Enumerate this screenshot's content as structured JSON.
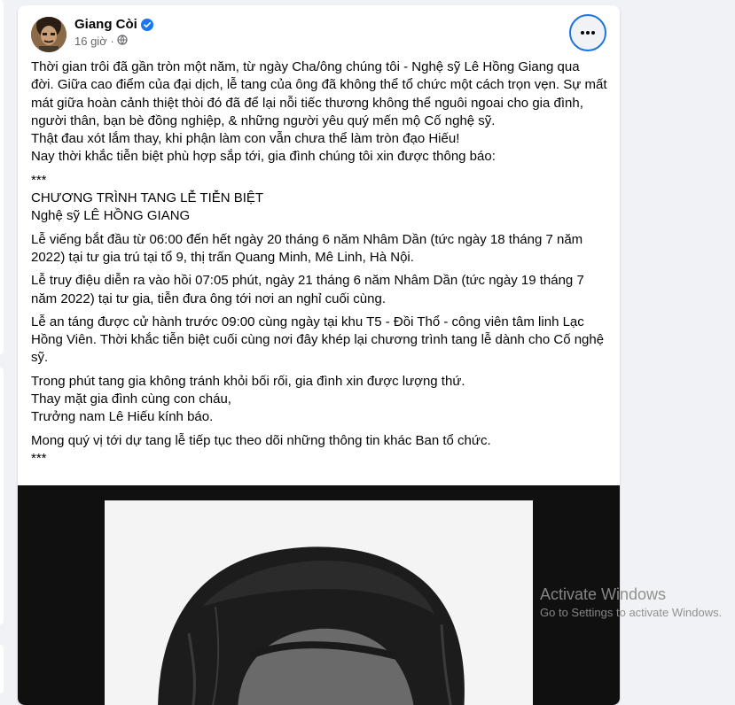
{
  "post": {
    "author": "Giang Còi",
    "time": "16 giờ ·",
    "icons": {
      "verified": "verified-badge-icon",
      "privacy": "globe-icon",
      "more": "more-options-icon"
    },
    "paragraphs": [
      {
        "lines": [
          "Thời gian trôi đã gần tròn một năm, từ ngày Cha/ông chúng tôi - Nghệ sỹ Lê Hồng Giang qua",
          "đời. Giữa cao điểm của đại dịch, lễ tang của ông đã không thể tổ chức một cách trọn vẹn. Sự mất",
          "mát giữa hoàn cảnh thiệt thòi đó đã để lại nỗi tiếc thương không thể nguôi ngoai cho gia đình,",
          "người thân, bạn bè đồng nghiệp, & những người yêu quý mến mộ Cố nghệ sỹ.",
          "Thật đau xót lắm thay, khi phận làm con vẫn chưa thể làm tròn đạo Hiếu!",
          "Nay thời khắc tiễn biệt phù hợp sắp tới, gia đình chúng tôi xin được thông báo:"
        ]
      },
      {
        "lines": [
          "***",
          "CHƯƠNG TRÌNH TANG LỄ TIỄN BIỆT",
          "Nghệ sỹ LÊ HỒNG GIANG"
        ]
      },
      {
        "lines": [
          "Lễ viếng bắt đầu từ 06:00 đến hết ngày 20 tháng 6 năm Nhâm Dần (tức ngày 18 tháng 7 năm",
          "2022) tại tư gia trú tại tổ 9, thị trấn Quang Minh, Mê Linh, Hà Nội."
        ]
      },
      {
        "lines": [
          "Lễ truy điệu diễn ra vào hồi 07:05 phút, ngày 21 tháng 6 năm Nhâm Dần (tức ngày 19 tháng 7",
          "năm 2022) tại tư gia, tiễn đưa ông tới nơi an nghỉ cuối cùng."
        ]
      },
      {
        "lines": [
          "Lễ an táng được cử hành trước 09:00 cùng ngày tại khu T5 - Đồi Thổ - công viên tâm linh Lạc",
          "Hồng Viên. Thời khắc tiễn biệt cuối cùng nơi đây khép lại chương trình tang lễ dành cho Cố nghệ",
          "sỹ."
        ]
      },
      {
        "lines": [
          "Trong phút tang gia không tránh khỏi bối rối, gia đình xin được lượng thứ.",
          "Thay mặt gia đình cùng con cháu,",
          "Trưởng nam Lê Hiếu kính báo."
        ]
      },
      {
        "lines": [
          "Mong quý vị tới dự tang lễ tiếp tục theo dõi những thông tin khác Ban tổ chức.",
          "***"
        ]
      }
    ]
  },
  "watermark": {
    "title": "Activate Windows",
    "subtitle": "Go to Settings to activate Windows."
  },
  "colors": {
    "accent": "#1b74e4",
    "verified": "#1877f2",
    "text": "#050505",
    "secondary": "#65676b",
    "background": "#f0f2f5"
  }
}
